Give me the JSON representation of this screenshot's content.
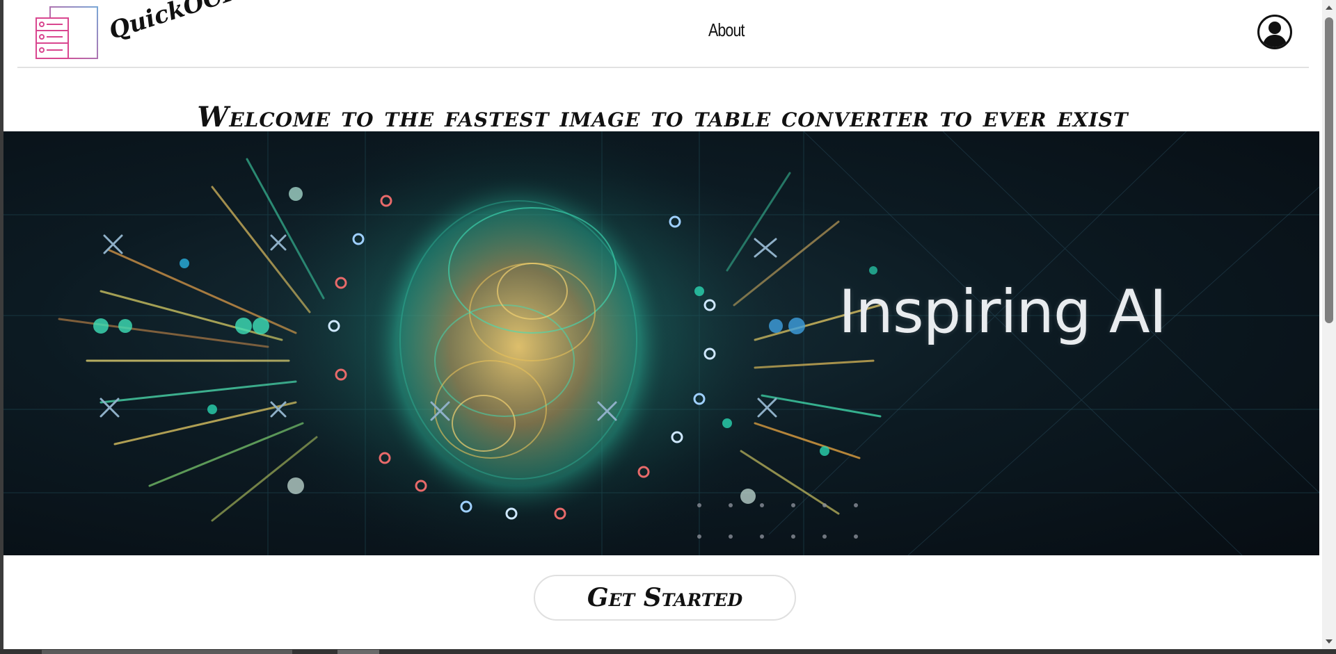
{
  "app": {
    "name": "QuickOCR"
  },
  "nav": {
    "about_label": "About"
  },
  "hero": {
    "headline": "Welcome to the fastest image to table converter to ever exist",
    "banner_text": "Inspiring AI"
  },
  "cta": {
    "label": "Get Started"
  },
  "colors": {
    "logo_pink": "#d9468f",
    "logo_blue": "#6ea8d8",
    "hero_bg": "#0c1a22",
    "hero_teal": "#2ad4b0",
    "hero_gold": "#e7c15a"
  },
  "icons": {
    "logo": "table-grid-icon",
    "avatar": "user-avatar-icon"
  }
}
